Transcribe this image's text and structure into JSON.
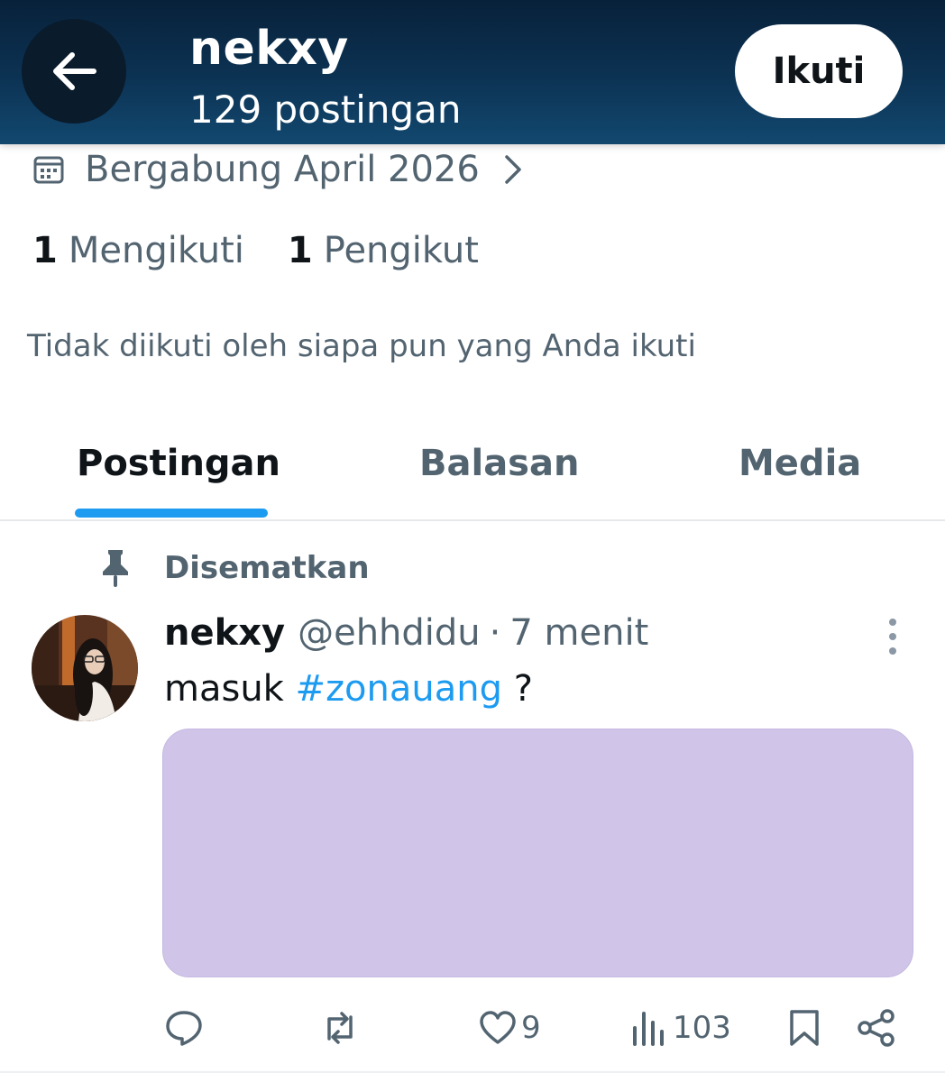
{
  "header": {
    "name": "nekxy",
    "post_count": "129 postingan",
    "follow_label": "Ikuti"
  },
  "profile": {
    "joined": "Bergabung April 2026",
    "following_count": "1",
    "following_label": "Mengikuti",
    "followers_count": "1",
    "followers_label": "Pengikut",
    "not_followed_text": "Tidak diikuti oleh siapa pun yang Anda ikuti"
  },
  "tabs": [
    {
      "label": "Postingan",
      "active": true
    },
    {
      "label": "Balasan",
      "active": false
    },
    {
      "label": "Media",
      "active": false
    }
  ],
  "post": {
    "pinned_label": "Disematkan",
    "author": "nekxy",
    "handle": "@ehhdidu",
    "separator": "·",
    "time": "7 menit",
    "text_prefix": "masuk ",
    "hashtag": "#zonauang",
    "text_suffix": " ?",
    "media_color": "#d0c5e9",
    "likes": "9",
    "views": "103"
  },
  "colors": {
    "accent": "#1d9bf0",
    "header_dark": "#08213a",
    "header_light": "#12486f",
    "muted_text": "#536471"
  }
}
